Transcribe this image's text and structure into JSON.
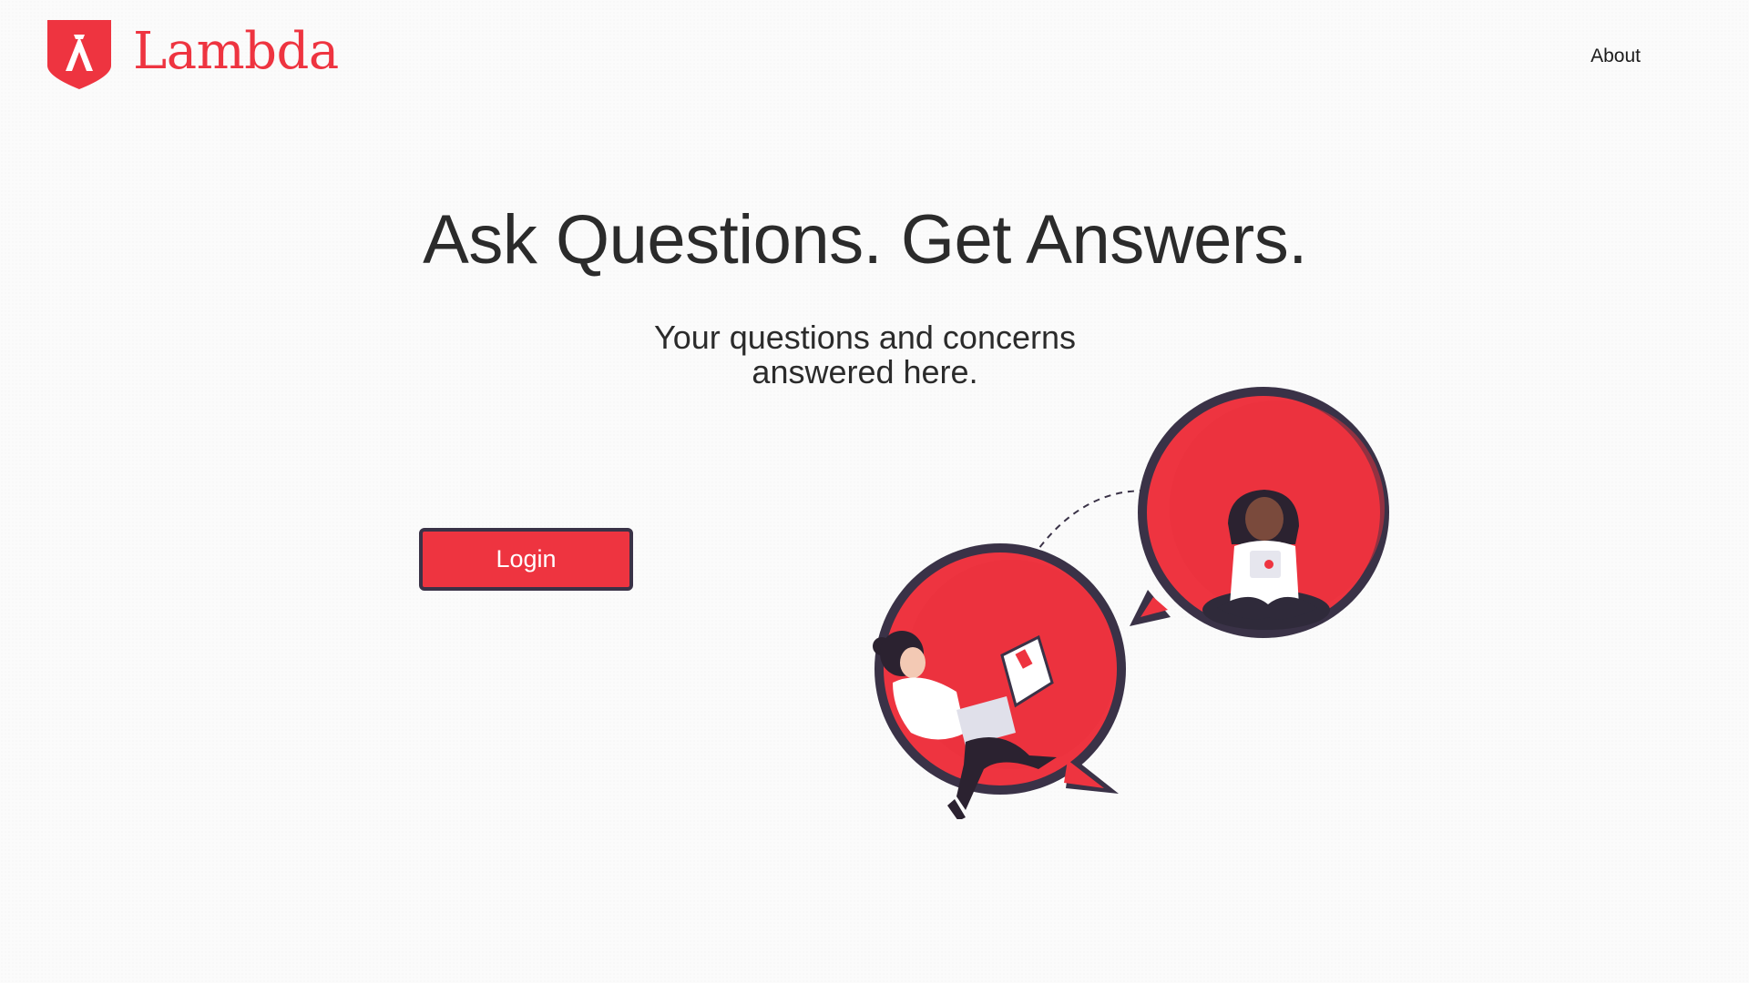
{
  "brand": {
    "name": "Lambda",
    "logo_icon": "lambda-shield-icon",
    "accent_color": "#ee3440",
    "dark_color": "#3a3247"
  },
  "nav": {
    "about_label": "About"
  },
  "hero": {
    "title": "Ask Questions. Get Answers.",
    "subtitle_line1": "Your questions and concerns",
    "subtitle_line2": "answered here."
  },
  "actions": {
    "login_label": "Login"
  },
  "illustration": {
    "icon": "chat-bubbles-people-illustration"
  }
}
